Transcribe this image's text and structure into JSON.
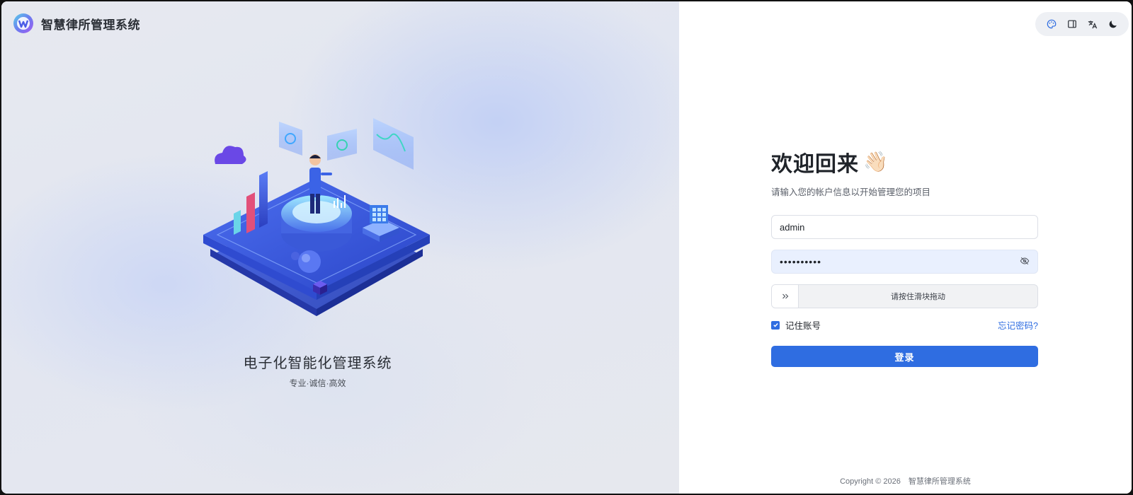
{
  "brand": {
    "name": "智慧律所管理系统"
  },
  "hero": {
    "title": "电子化智能化管理系统",
    "subtitle": "专业·诚信·高效"
  },
  "toolbar": {
    "icons": [
      "palette-icon",
      "layout-icon",
      "translate-icon",
      "moon-icon"
    ]
  },
  "login": {
    "title": "欢迎回来",
    "wave_emoji": "👋🏻",
    "subtitle": "请输入您的帐户信息以开始管理您的项目",
    "username_value": "admin",
    "password_mask": "••••••••••",
    "slider_text": "请按住滑块拖动",
    "remember_label": "记住账号",
    "remember_checked": true,
    "forgot_label": "忘记密码?",
    "submit_label": "登录"
  },
  "footer": {
    "copyright": "Copyright © 2026",
    "company": "智慧律所管理系统"
  },
  "colors": {
    "primary": "#2f6de1",
    "password_field_bg": "#e9f0fe"
  }
}
